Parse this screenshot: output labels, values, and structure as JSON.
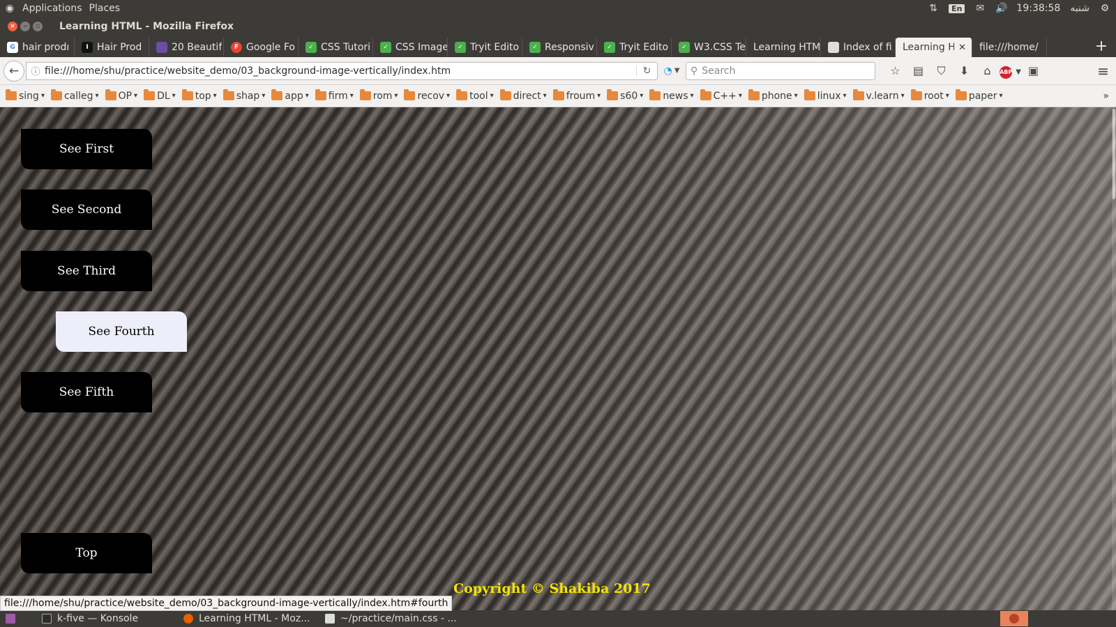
{
  "system_panel": {
    "menus": [
      "Applications",
      "Places"
    ],
    "lang": "En",
    "time": "19:38:58",
    "day": "شنبه"
  },
  "window": {
    "title": "Learning HTML - Mozilla Firefox"
  },
  "tabs": [
    {
      "label": "hair prodı",
      "favicon_color": "#4285f4",
      "favicon_text": "G"
    },
    {
      "label": "Hair Prod",
      "favicon_color": "#111111",
      "favicon_text": "I"
    },
    {
      "label": "20 Beautif",
      "favicon_color": "#6a4ea1",
      "favicon_text": ""
    },
    {
      "label": "Google Fo",
      "favicon_color": "#ea4335",
      "favicon_text": "F"
    },
    {
      "label": "CSS Tutori",
      "favicon_color": "#4caf50",
      "favicon_text": ""
    },
    {
      "label": "CSS Image",
      "favicon_color": "#4caf50",
      "favicon_text": ""
    },
    {
      "label": "Tryit Edito",
      "favicon_color": "#4caf50",
      "favicon_text": ""
    },
    {
      "label": "Responsiv",
      "favicon_color": "#4caf50",
      "favicon_text": ""
    },
    {
      "label": "Tryit Edito",
      "favicon_color": "#4caf50",
      "favicon_text": ""
    },
    {
      "label": "W3.CSS Te",
      "favicon_color": "#4caf50",
      "favicon_text": ""
    },
    {
      "label": "Learning HTM",
      "favicon_color": "",
      "favicon_text": ""
    },
    {
      "label": "Index of fi",
      "favicon_color": "#dddddd",
      "favicon_text": ""
    },
    {
      "label": "Learning H",
      "favicon_color": "",
      "favicon_text": "",
      "active": true
    },
    {
      "label": "file:///home/",
      "favicon_color": "",
      "favicon_text": ""
    }
  ],
  "navbar": {
    "url": "file:///home/shu/practice/website_demo/03_background-image-vertically/index.htm",
    "search_placeholder": "Search"
  },
  "bookmarks": [
    "sing",
    "calleg",
    "OP",
    "DL",
    "top",
    "shap",
    "app",
    "firm",
    "rom",
    "recov",
    "tool",
    "direct",
    "froum",
    "s60",
    "news",
    "C++",
    "phone",
    "linux",
    "v.learn",
    "root",
    "paper"
  ],
  "page": {
    "buttons": [
      "See First",
      "See Second",
      "See Third",
      "See Fourth",
      "See Fifth",
      "Top"
    ],
    "hovered_button": "See Fourth",
    "copyright": "Copyright © Shakiba 2017",
    "status_link": "file:///home/shu/practice/website_demo/03_background-image-vertically/index.htm#fourth"
  },
  "taskbar": [
    {
      "label": "k-five — Konsole",
      "icon_color": "#2d2d2d"
    },
    {
      "label": "Learning HTML - Moz...",
      "icon_color": "#e66000"
    },
    {
      "label": "~/practice/main.css - ...",
      "icon_color": "#dddddd"
    }
  ],
  "colors": {
    "accent_yellow": "#f2e400",
    "button_bg": "#000000",
    "hover_bg": "#eeeefa"
  }
}
